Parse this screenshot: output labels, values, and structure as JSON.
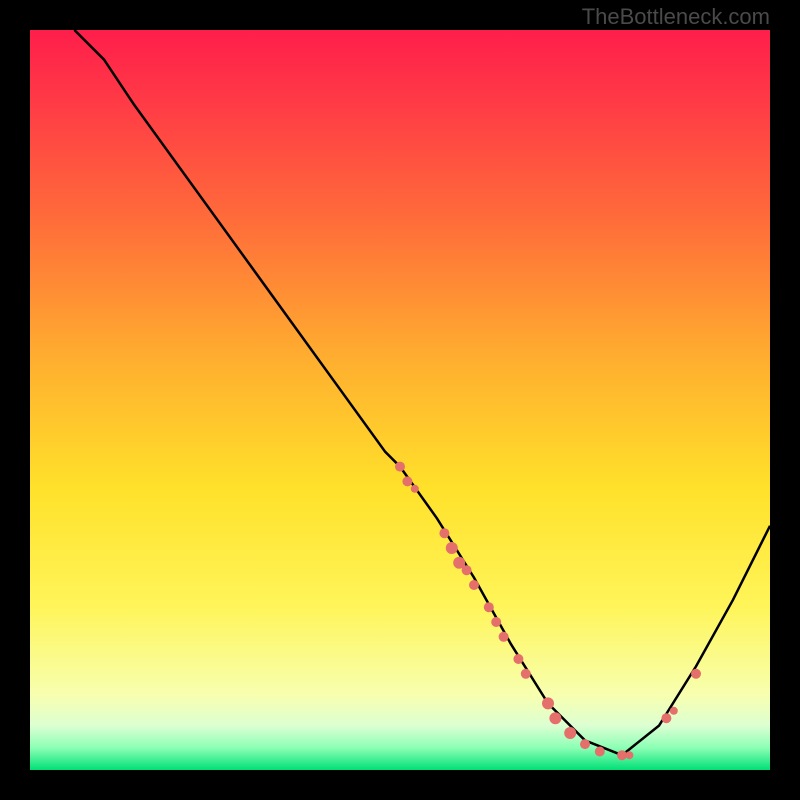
{
  "watermark": "TheBottleneck.com",
  "dot_color": "#e46f6b",
  "curve_color": "#000000",
  "chart_data": {
    "type": "line",
    "title": "",
    "xlabel": "",
    "ylabel": "",
    "xlim": [
      0,
      100
    ],
    "ylim": [
      0,
      100
    ],
    "curve": [
      {
        "x": 6,
        "y": 100
      },
      {
        "x": 10,
        "y": 96
      },
      {
        "x": 14,
        "y": 90
      },
      {
        "x": 48,
        "y": 43
      },
      {
        "x": 50,
        "y": 41
      },
      {
        "x": 55,
        "y": 34
      },
      {
        "x": 60,
        "y": 26
      },
      {
        "x": 65,
        "y": 17
      },
      {
        "x": 70,
        "y": 9
      },
      {
        "x": 75,
        "y": 4
      },
      {
        "x": 80,
        "y": 2
      },
      {
        "x": 85,
        "y": 6
      },
      {
        "x": 90,
        "y": 14
      },
      {
        "x": 95,
        "y": 23
      },
      {
        "x": 100,
        "y": 33
      }
    ],
    "dots": [
      {
        "x": 50,
        "y": 41,
        "r": 5
      },
      {
        "x": 51,
        "y": 39,
        "r": 5
      },
      {
        "x": 52,
        "y": 38,
        "r": 4
      },
      {
        "x": 56,
        "y": 32,
        "r": 5
      },
      {
        "x": 57,
        "y": 30,
        "r": 6
      },
      {
        "x": 58,
        "y": 28,
        "r": 6
      },
      {
        "x": 59,
        "y": 27,
        "r": 5
      },
      {
        "x": 60,
        "y": 25,
        "r": 5
      },
      {
        "x": 62,
        "y": 22,
        "r": 5
      },
      {
        "x": 63,
        "y": 20,
        "r": 5
      },
      {
        "x": 64,
        "y": 18,
        "r": 5
      },
      {
        "x": 66,
        "y": 15,
        "r": 5
      },
      {
        "x": 67,
        "y": 13,
        "r": 5
      },
      {
        "x": 70,
        "y": 9,
        "r": 6
      },
      {
        "x": 71,
        "y": 7,
        "r": 6
      },
      {
        "x": 73,
        "y": 5,
        "r": 6
      },
      {
        "x": 75,
        "y": 3.5,
        "r": 5
      },
      {
        "x": 77,
        "y": 2.5,
        "r": 5
      },
      {
        "x": 80,
        "y": 2,
        "r": 5
      },
      {
        "x": 81,
        "y": 2,
        "r": 4
      },
      {
        "x": 86,
        "y": 7,
        "r": 5
      },
      {
        "x": 87,
        "y": 8,
        "r": 4
      },
      {
        "x": 90,
        "y": 13,
        "r": 5
      }
    ]
  }
}
